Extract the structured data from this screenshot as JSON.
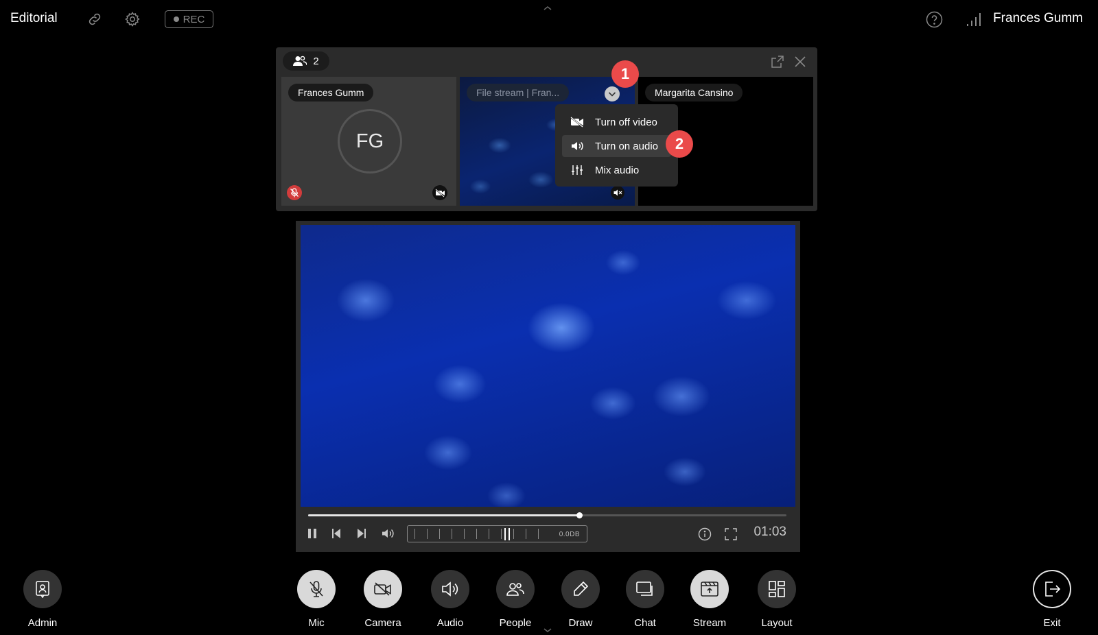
{
  "app": {
    "title": "Editorial",
    "rec_label": "REC",
    "user_name": "Frances Gumm"
  },
  "panel": {
    "people_count": "2",
    "tiles": [
      {
        "name": "Frances Gumm",
        "initials": "FG"
      },
      {
        "name": "File stream | Fran..."
      },
      {
        "name": "Margarita Cansino"
      }
    ]
  },
  "tile_menu": {
    "items": [
      "Turn off video",
      "Turn on audio",
      "Mix audio"
    ]
  },
  "steps": [
    "1",
    "2"
  ],
  "player": {
    "level_readout": "0.0DB",
    "time": "01:03",
    "progress": 0.566
  },
  "dock": {
    "admin": "Admin",
    "mic": "Mic",
    "camera": "Camera",
    "audio": "Audio",
    "people": "People",
    "draw": "Draw",
    "chat": "Chat",
    "stream": "Stream",
    "layout": "Layout",
    "exit": "Exit"
  },
  "colors": {
    "accent_red": "#ea4a4a",
    "mic_muted": "#d23c3c",
    "panel_bg": "#2b2b2b"
  }
}
